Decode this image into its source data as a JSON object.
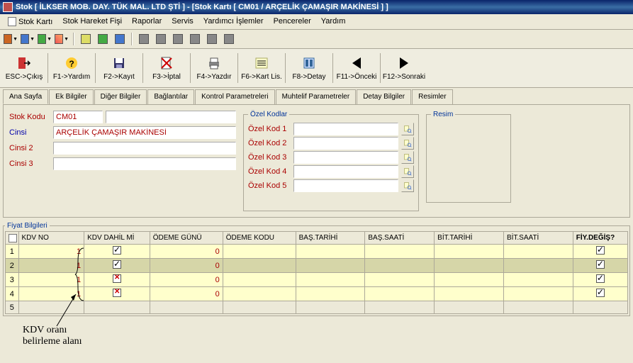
{
  "title": "Stok [ İLKSER MOB. DAY. TÜK MAL. LTD ŞTİ ]  - [Stok Kartı [ CM01 / ARÇELİK ÇAMAŞIR MAKİNESİ ] ]",
  "menu": {
    "stok_karti": "Stok Kartı",
    "stok_hareket": "Stok Hareket Fişi",
    "raporlar": "Raporlar",
    "servis": "Servis",
    "yardimci": "Yardımcı İşlemler",
    "pencereler": "Pencereler",
    "yardim": "Yardım"
  },
  "bigtoolbar": {
    "esc": "ESC->Çıkış",
    "f1": "F1->Yardım",
    "f2": "F2->Kayıt",
    "f3": "F3->İptal",
    "f4": "F4->Yazdır",
    "f6": "F6->Kart Lis.",
    "f8": "F8->Detay",
    "f11": "F11->Önceki",
    "f12": "F12->Sonraki"
  },
  "tabs": {
    "ana": "Ana Sayfa",
    "ek": "Ek Bilgiler",
    "diger": "Diğer Bilgiler",
    "bag": "Bağlantılar",
    "kontrol": "Kontrol Parametreleri",
    "muhtelif": "Muhtelif Parametreler",
    "detay": "Detay Bilgiler",
    "resimler": "Resimler"
  },
  "fields": {
    "stok_kodu_label": "Stok Kodu",
    "stok_kodu_value": "CM01",
    "cinsi_label": "Cinsi",
    "cinsi_value": "ARÇELİK ÇAMAŞIR MAKİNESİ",
    "cinsi2_label": "Cinsi 2",
    "cinsi2_value": "",
    "cinsi3_label": "Cinsi 3",
    "cinsi3_value": ""
  },
  "ozel": {
    "legend": "Özel Kodlar",
    "label1": "Özel Kod 1",
    "label2": "Özel Kod 2",
    "label3": "Özel Kod 3",
    "label4": "Özel Kod 4",
    "label5": "Özel Kod 5"
  },
  "resim_legend": "Resim",
  "fiyat_legend": "Fiyat Bilgileri",
  "grid": {
    "headers": {
      "kdv_no": "KDV NO",
      "kdv_dahil": "KDV DAHİL Mİ",
      "odeme_gunu": "ÖDEME GÜNÜ",
      "odeme_kodu": "ÖDEME KODU",
      "bas_tarihi": "BAŞ.TARİHİ",
      "bas_saati": "BAŞ.SAATİ",
      "bit_tarihi": "BİT.TARİHİ",
      "bit_saati": "BİT.SAATİ",
      "fiy_degis": "FİY.DEĞİŞ?"
    },
    "rows": [
      {
        "n": "1",
        "kdv_no": "1",
        "dahil": "check",
        "gun": "0",
        "fiy": "check"
      },
      {
        "n": "2",
        "kdv_no": "1",
        "dahil": "check",
        "gun": "0",
        "fiy": "check"
      },
      {
        "n": "3",
        "kdv_no": "1",
        "dahil": "cross",
        "gun": "0",
        "fiy": "check"
      },
      {
        "n": "4",
        "kdv_no": "1",
        "dahil": "cross",
        "gun": "0",
        "fiy": "check"
      },
      {
        "n": "5",
        "kdv_no": "",
        "dahil": "",
        "gun": "",
        "fiy": ""
      }
    ]
  },
  "annotation": "KDV oranı\nbelirleme alanı"
}
